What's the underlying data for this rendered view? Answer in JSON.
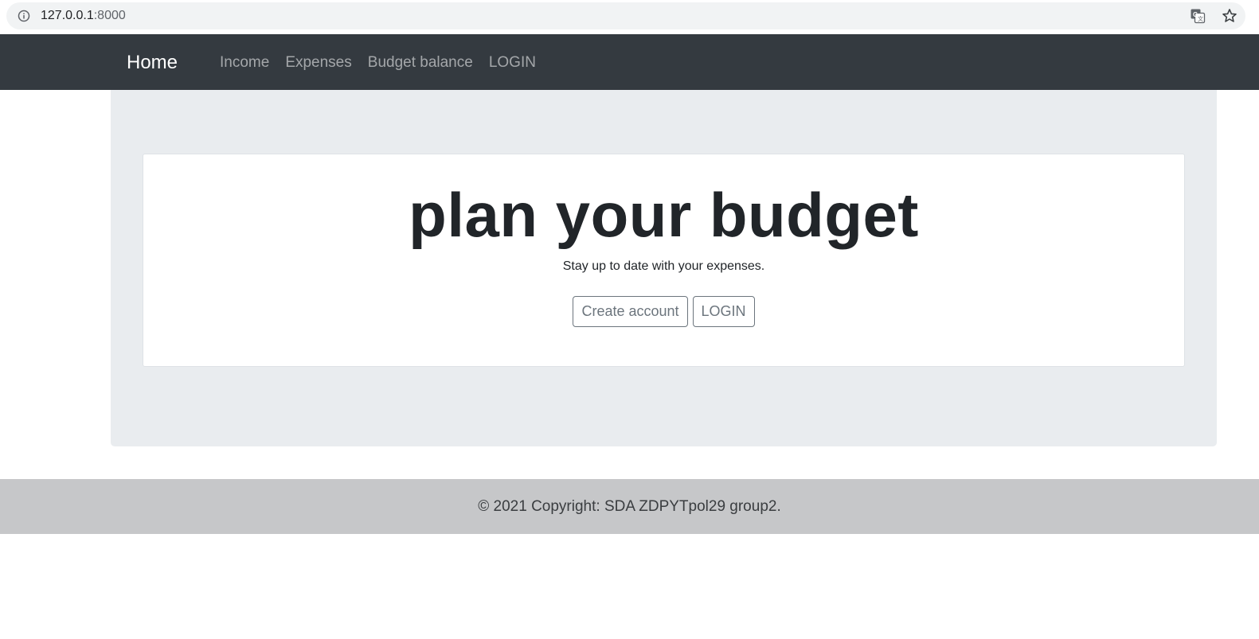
{
  "browser": {
    "url_host": "127.0.0.1",
    "url_port": ":8000",
    "icons": [
      "info-icon",
      "translate-icon",
      "bookmark-star-icon"
    ]
  },
  "navbar": {
    "brand": "Home",
    "links": [
      "Income",
      "Expenses",
      "Budget balance",
      "LOGIN"
    ]
  },
  "hero": {
    "title": "plan your budget",
    "subtitle": "Stay up to date with your expenses.",
    "create_account_label": "Create account",
    "login_label": "LOGIN"
  },
  "footer": {
    "text": "© 2021 Copyright: SDA ZDPYTpol29 group2."
  },
  "colors": {
    "navbar_bg": "#343a40",
    "jumbotron_bg": "#e9ecef",
    "footer_bg": "#c6c7c9",
    "button_border": "#6c757d"
  }
}
